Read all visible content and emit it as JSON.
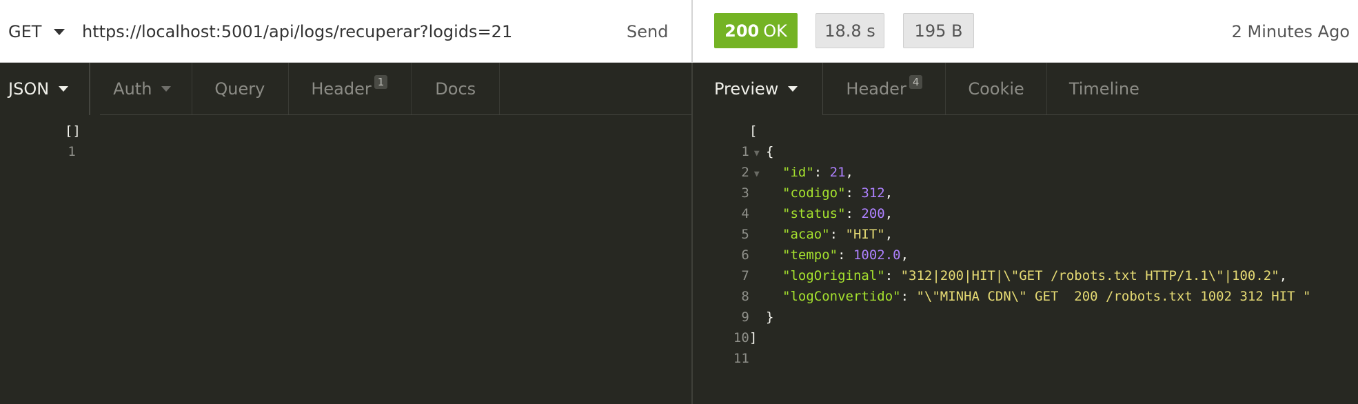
{
  "request": {
    "method": "GET",
    "url": "https://localhost:5001/api/logs/recuperar?logids=21",
    "send_label": "Send"
  },
  "response_meta": {
    "status_code": "200",
    "status_text": "OK",
    "time": "18.8 s",
    "size": "195 B",
    "ago": "2 Minutes Ago"
  },
  "request_tabs": [
    {
      "label": "JSON",
      "active": true
    },
    {
      "label": "Auth"
    },
    {
      "label": "Query"
    },
    {
      "label": "Header",
      "count": "1"
    },
    {
      "label": "Docs"
    }
  ],
  "response_tabs": [
    {
      "label": "Preview",
      "active": true
    },
    {
      "label": "Header",
      "count": "4"
    },
    {
      "label": "Cookie"
    },
    {
      "label": "Timeline"
    }
  ],
  "request_body": {
    "line_numbers": [
      "1"
    ],
    "content": "[]"
  },
  "response_body": {
    "line_numbers": [
      "1",
      "2",
      "3",
      "4",
      "5",
      "6",
      "7",
      "8",
      "9",
      "10",
      "11"
    ],
    "open_bracket": "[",
    "open_brace": "{",
    "fields": [
      {
        "key": "\"id\"",
        "value": "21",
        "type": "number"
      },
      {
        "key": "\"codigo\"",
        "value": "312",
        "type": "number"
      },
      {
        "key": "\"status\"",
        "value": "200",
        "type": "number"
      },
      {
        "key": "\"acao\"",
        "value": "\"HIT\"",
        "type": "string"
      },
      {
        "key": "\"tempo\"",
        "value": "1002.0",
        "type": "number"
      },
      {
        "key": "\"logOriginal\"",
        "value": "\"312|200|HIT|\\\"GET /robots.txt HTTP/1.1\\\"|100.2\"",
        "type": "string"
      },
      {
        "key": "\"logConvertido\"",
        "value": "\"\\\"MINHA CDN\\\" GET  200 /robots.txt 1002 312 HIT \"",
        "type": "string"
      }
    ],
    "close_brace": "}",
    "close_bracket": "]"
  },
  "colors": {
    "status_ok": "#74b324",
    "editor_bg": "#272822",
    "key": "#a6e22e",
    "number": "#ae81ff",
    "string": "#e6db74"
  }
}
